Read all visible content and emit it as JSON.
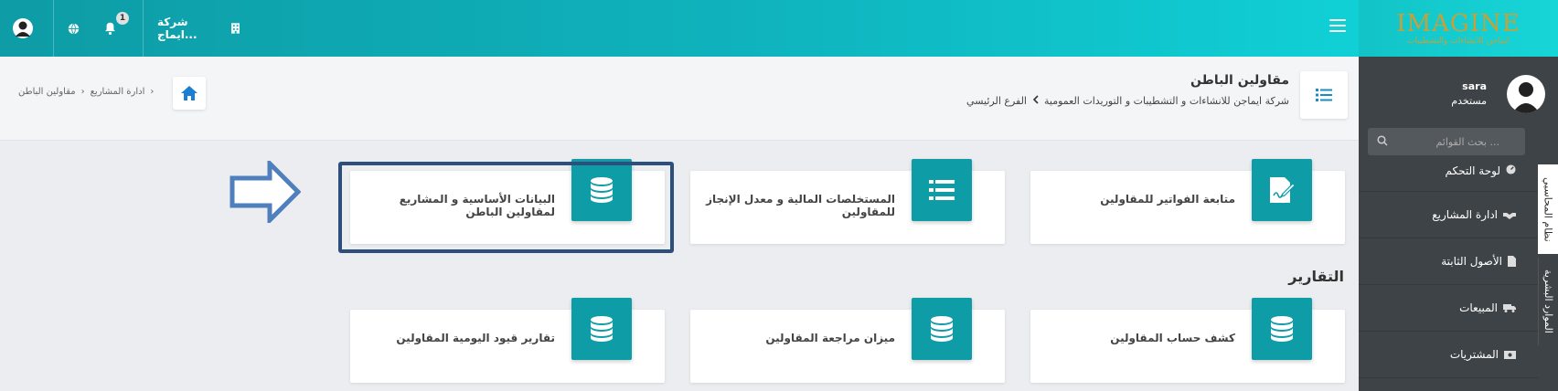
{
  "topbar": {
    "notification_count": "1",
    "company_name": "شركة ايماج..."
  },
  "logo": {
    "text": "IMAGINE",
    "subtitle": "ايماجن للانشاءات والتشطيبات"
  },
  "sidebar": {
    "user_name": "sara",
    "user_role": "مستخدم",
    "search_placeholder": "بحث القوائم ...",
    "items": [
      {
        "label": "لوحة التحكم",
        "icon": "dashboard-icon"
      },
      {
        "label": "ادارة المشاريع",
        "icon": "handshake-icon"
      },
      {
        "label": "الأصول الثابتة",
        "icon": "file-icon"
      },
      {
        "label": "المبيعات",
        "icon": "truck-icon"
      },
      {
        "label": "المشتريات",
        "icon": "money-icon"
      }
    ],
    "tabs": [
      {
        "label": "نظام المحاسبي",
        "active": true
      },
      {
        "label": "الموارد البشرية",
        "active": false
      }
    ]
  },
  "header": {
    "title": "مقاولين الباطن",
    "company": "شركة ايماجن للانشاءات و التشطيبات و التوريدات العمومية",
    "branch": "الفرع الرئيسي",
    "breadcrumb": [
      "ادارة المشاريع",
      "مقاولين الباطن"
    ]
  },
  "cards": [
    {
      "label": "متابعة الفواتير للمقاولين",
      "icon": "invoice-sign-icon"
    },
    {
      "label": "المستخلصات المالية و معدل الإنجاز للمقاولين",
      "icon": "list-icon"
    },
    {
      "label": "البيانات الأساسية و المشاريع لمقاولين الباطن",
      "icon": "database-icon"
    }
  ],
  "reports": {
    "title": "التقارير",
    "cards": [
      {
        "label": "كشف حساب المقاولين",
        "icon": "database-icon"
      },
      {
        "label": "ميزان مراجعة المقاولين",
        "icon": "database-icon"
      },
      {
        "label": "تقارير قيود اليومية المقاولين",
        "icon": "database-icon"
      }
    ]
  },
  "colors": {
    "accent": "#0e9ca6",
    "sidebar": "#3e4347",
    "highlight_border": "#2e4f7c",
    "arrow": "#4f7fbd"
  }
}
